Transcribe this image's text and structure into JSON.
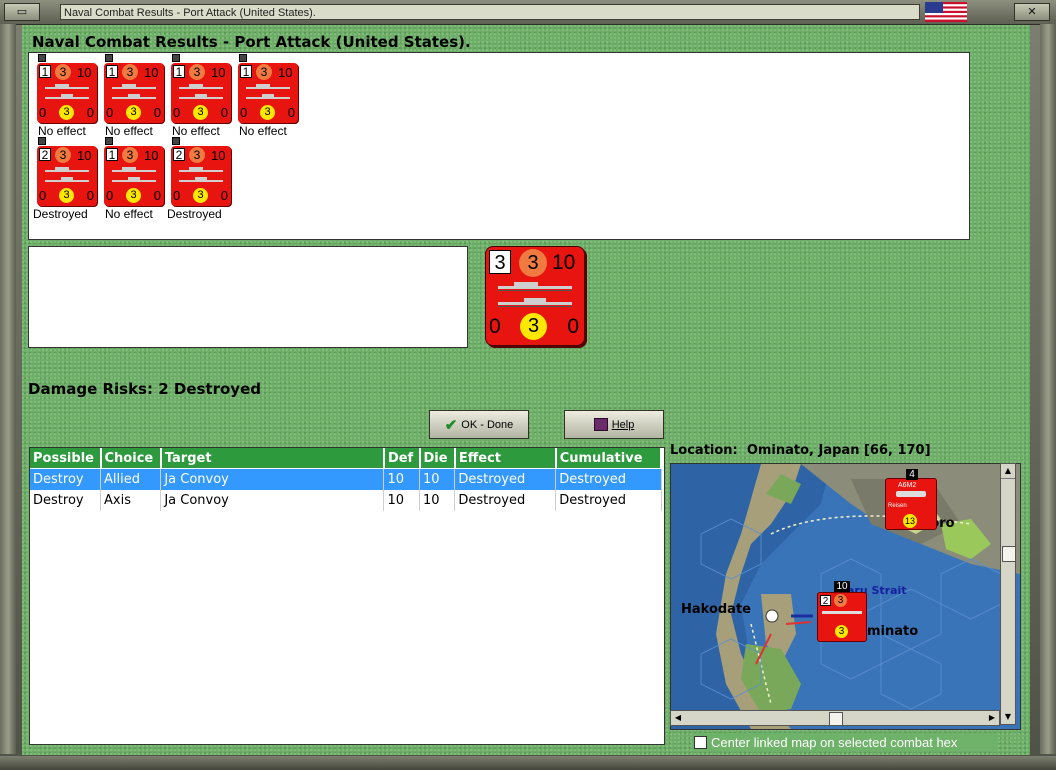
{
  "window": {
    "title": "Naval Combat Results - Port Attack (United States).",
    "flag_icon": "us-flag-icon"
  },
  "heading": "Naval Combat Results - Port Attack (United States).",
  "units": [
    {
      "strength": "1",
      "attack": "3",
      "range": "10",
      "left": "0",
      "mid": "3",
      "right": "0",
      "effect": "No effect"
    },
    {
      "strength": "1",
      "attack": "3",
      "range": "10",
      "left": "0",
      "mid": "3",
      "right": "0",
      "effect": "No effect"
    },
    {
      "strength": "1",
      "attack": "3",
      "range": "10",
      "left": "0",
      "mid": "3",
      "right": "0",
      "effect": "No effect"
    },
    {
      "strength": "1",
      "attack": "3",
      "range": "10",
      "left": "0",
      "mid": "3",
      "right": "0",
      "effect": "No effect"
    },
    {
      "strength": "2",
      "attack": "3",
      "range": "10",
      "left": "0",
      "mid": "3",
      "right": "0",
      "effect": "Destroyed"
    },
    {
      "strength": "1",
      "attack": "3",
      "range": "10",
      "left": "0",
      "mid": "3",
      "right": "0",
      "effect": "No effect"
    },
    {
      "strength": "2",
      "attack": "3",
      "range": "10",
      "left": "0",
      "mid": "3",
      "right": "0",
      "effect": "Destroyed"
    }
  ],
  "big_counter": {
    "strength": "3",
    "attack": "3",
    "range": "10",
    "left": "0",
    "mid": "3",
    "right": "0"
  },
  "damage": {
    "label": "Damage Risks:",
    "value": "2 Destroyed"
  },
  "buttons": {
    "ok": "OK - Done",
    "help": "Help"
  },
  "table": {
    "columns": [
      "Possible",
      "Choice",
      "Target",
      "Def",
      "Die",
      "Effect",
      "Cumulative"
    ],
    "rows": [
      {
        "possible": "Destroy",
        "choice": "Allied",
        "target": "Ja Convoy",
        "def": "10",
        "die": "10",
        "effect": "Destroyed",
        "cumulative": "Destroyed"
      },
      {
        "possible": "Destroy",
        "choice": "Axis",
        "target": "Ja Convoy",
        "def": "10",
        "die": "10",
        "effect": "Destroyed",
        "cumulative": "Destroyed"
      }
    ]
  },
  "location": {
    "label": "Location:",
    "value": "Ominato, Japan [66, 170]"
  },
  "map": {
    "labels": {
      "hakodate": "Hakodate",
      "ominato": "minato",
      "strait": "aru Strait",
      "poro": "poro"
    },
    "counter_top": {
      "number": "4",
      "label": "A6M2",
      "sub": "Reisen",
      "value": "13"
    },
    "counter_main": {
      "strength": "2",
      "attack": "3",
      "range": "10",
      "mid": "3"
    }
  },
  "checkbox": {
    "label": "Center linked map on selected combat hex",
    "checked": false
  }
}
